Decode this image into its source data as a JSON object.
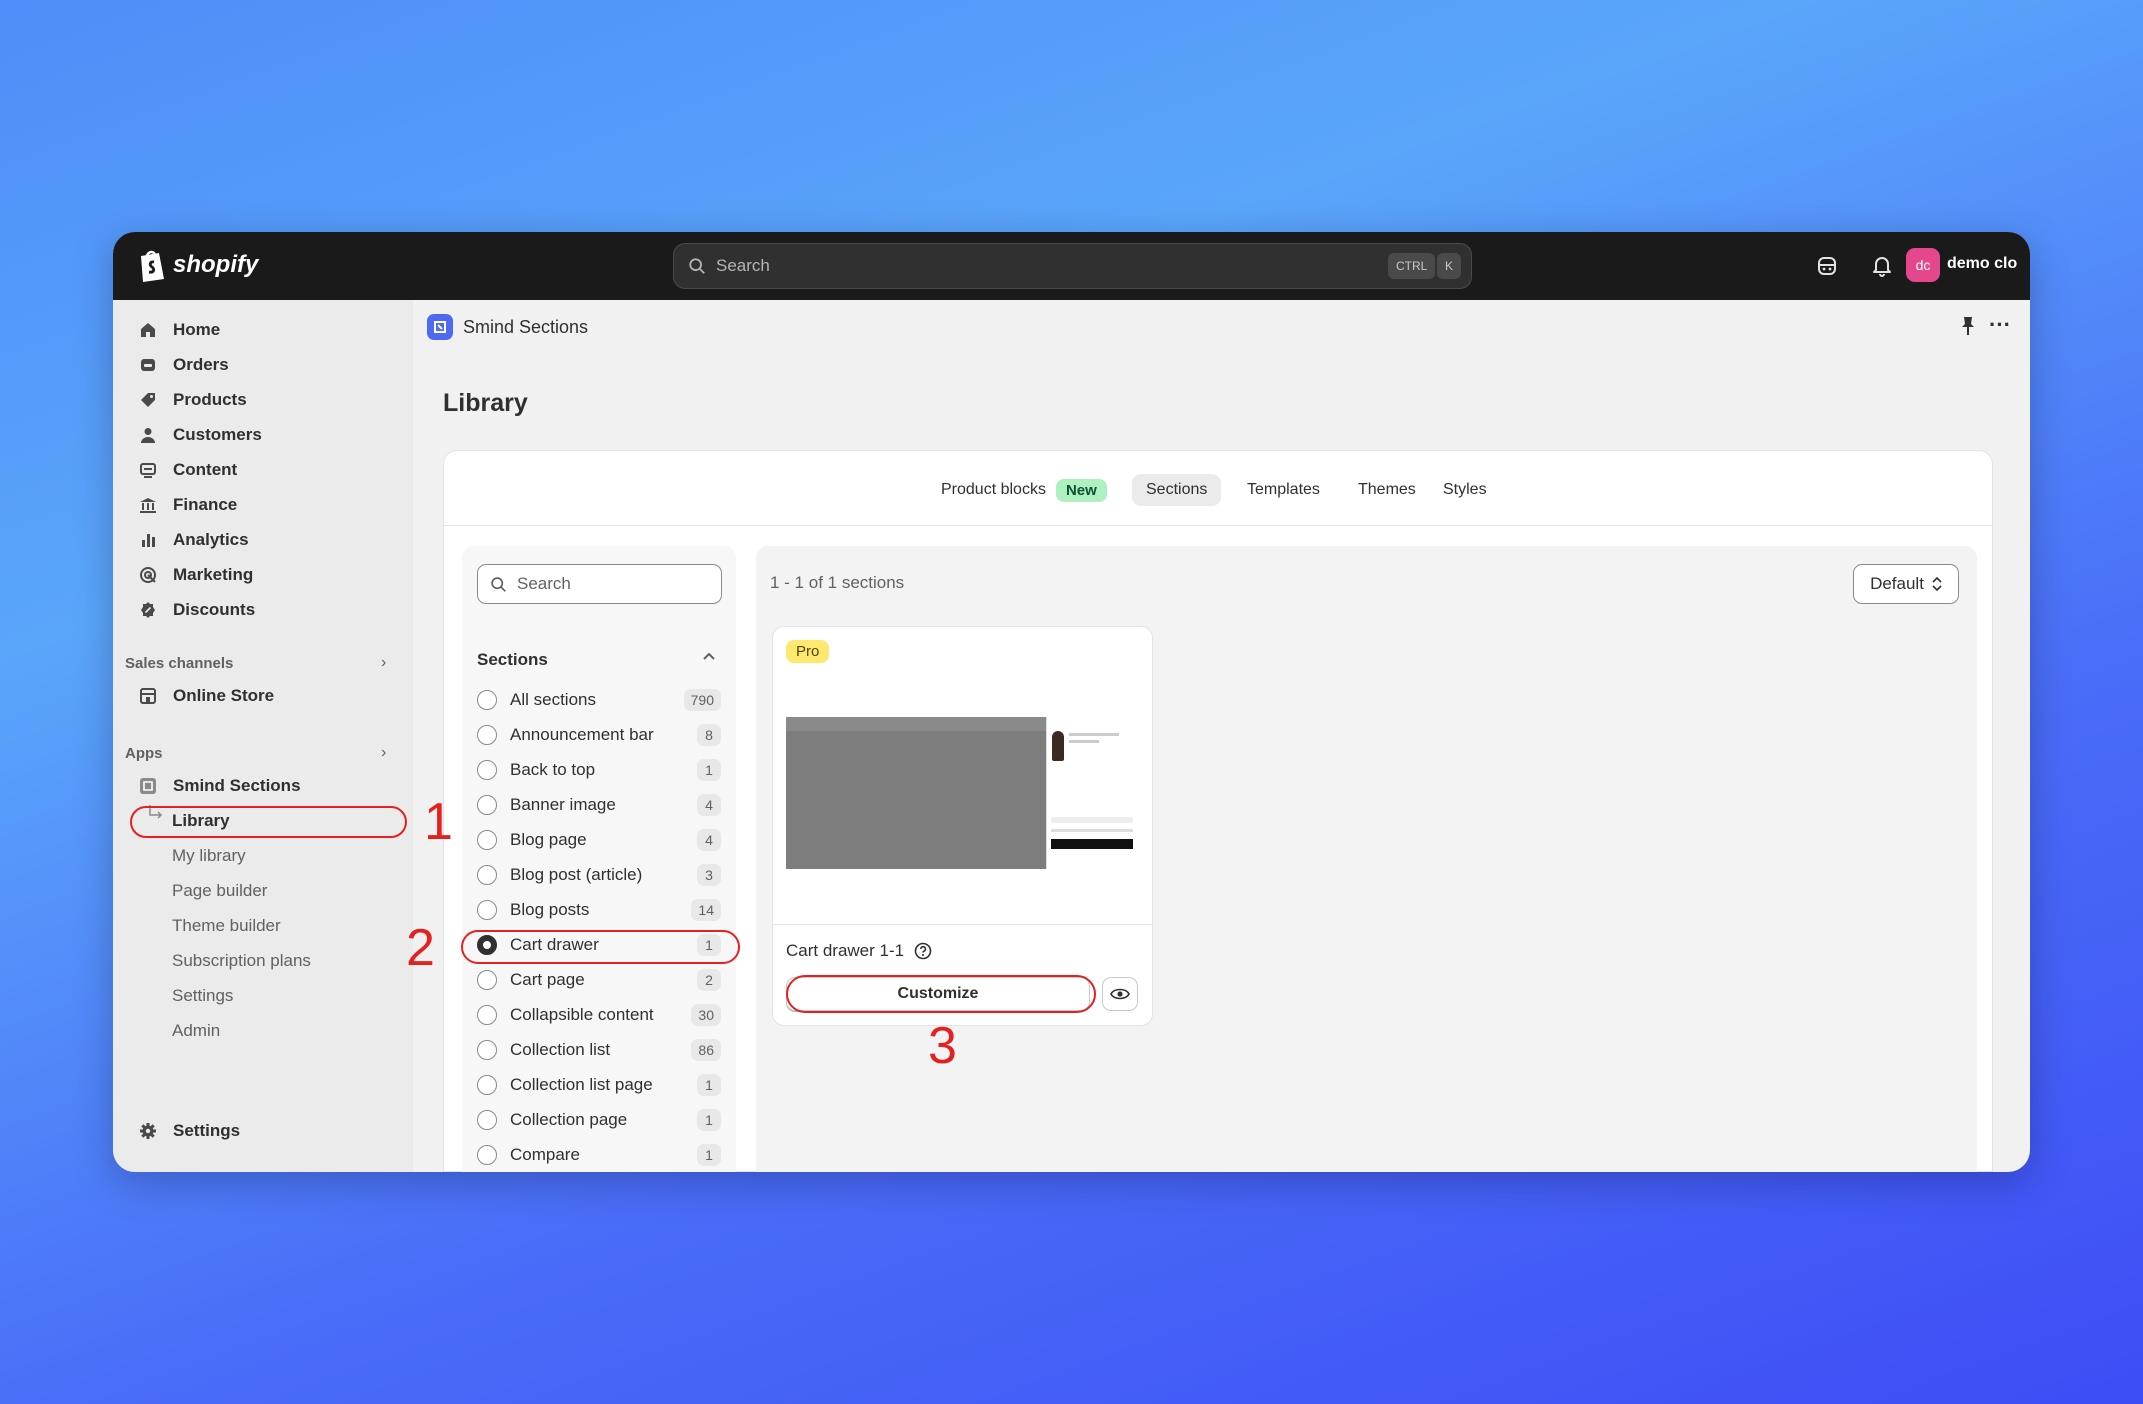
{
  "topbar": {
    "brand": "shopify",
    "search_placeholder": "Search",
    "shortcut_ctrl": "CTRL",
    "shortcut_key": "K",
    "avatar_initials": "dc",
    "store_name": "demo clo"
  },
  "sidebar": {
    "items": [
      {
        "label": "Home",
        "icon": "home-icon"
      },
      {
        "label": "Orders",
        "icon": "orders-icon"
      },
      {
        "label": "Products",
        "icon": "tag-icon"
      },
      {
        "label": "Customers",
        "icon": "person-icon"
      },
      {
        "label": "Content",
        "icon": "content-icon"
      },
      {
        "label": "Finance",
        "icon": "bank-icon"
      },
      {
        "label": "Analytics",
        "icon": "bar-chart-icon"
      },
      {
        "label": "Marketing",
        "icon": "target-icon"
      },
      {
        "label": "Discounts",
        "icon": "discount-icon"
      }
    ],
    "sales_channels_label": "Sales channels",
    "online_store": "Online Store",
    "apps_label": "Apps",
    "app_name": "Smind Sections",
    "app_subitems": [
      "Library",
      "My library",
      "Page builder",
      "Theme builder",
      "Subscription plans",
      "Settings",
      "Admin"
    ],
    "settings": "Settings"
  },
  "main": {
    "app_title": "Smind Sections",
    "page_title": "Library",
    "tabs": [
      {
        "label": "Product blocks",
        "badge": "New"
      },
      {
        "label": "Sections"
      },
      {
        "label": "Templates"
      },
      {
        "label": "Themes"
      },
      {
        "label": "Styles"
      }
    ],
    "active_tab": "Sections"
  },
  "filters": {
    "search_placeholder": "Search",
    "heading": "Sections",
    "options": [
      {
        "label": "All sections",
        "count": "790"
      },
      {
        "label": "Announcement bar",
        "count": "8"
      },
      {
        "label": "Back to top",
        "count": "1"
      },
      {
        "label": "Banner image",
        "count": "4"
      },
      {
        "label": "Blog page",
        "count": "4"
      },
      {
        "label": "Blog post (article)",
        "count": "3"
      },
      {
        "label": "Blog posts",
        "count": "14"
      },
      {
        "label": "Cart drawer",
        "count": "1"
      },
      {
        "label": "Cart page",
        "count": "2"
      },
      {
        "label": "Collapsible content",
        "count": "30"
      },
      {
        "label": "Collection list",
        "count": "86"
      },
      {
        "label": "Collection list page",
        "count": "1"
      },
      {
        "label": "Collection page",
        "count": "1"
      },
      {
        "label": "Compare",
        "count": "1"
      }
    ],
    "selected": "Cart drawer"
  },
  "results": {
    "count_text": "1 - 1 of 1 sections",
    "sort_label": "Default",
    "card": {
      "badge": "Pro",
      "name": "Cart drawer 1-1",
      "customize_label": "Customize"
    }
  },
  "annotations": {
    "numbers": [
      "1",
      "2",
      "3"
    ],
    "color": "#e52020"
  }
}
